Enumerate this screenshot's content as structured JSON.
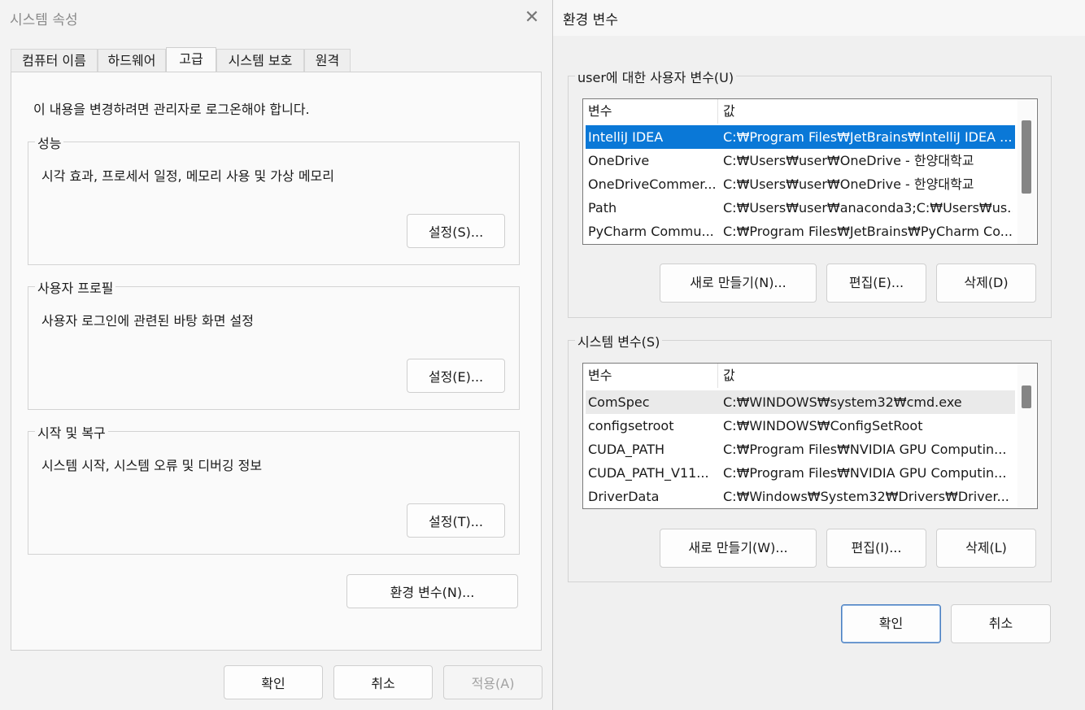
{
  "system_properties": {
    "title": "시스템 속성",
    "close_glyph": "✕",
    "tabs": [
      {
        "label": "컴퓨터 이름"
      },
      {
        "label": "하드웨어"
      },
      {
        "label": "고급"
      },
      {
        "label": "시스템 보호"
      },
      {
        "label": "원격"
      }
    ],
    "admin_note": "이 내용을 변경하려면 관리자로 로그온해야 합니다.",
    "groups": {
      "performance": {
        "title": "성능",
        "desc": "시각 효과, 프로세서 일정, 메모리 사용 및 가상 메모리",
        "button": "설정(S)..."
      },
      "user_profile": {
        "title": "사용자 프로필",
        "desc": "사용자 로그인에 관련된 바탕 화면 설정",
        "button": "설정(E)..."
      },
      "startup_recovery": {
        "title": "시작 및 복구",
        "desc": "시스템 시작, 시스템 오류 및 디버깅 정보",
        "button": "설정(T)..."
      }
    },
    "env_button": "환경 변수(N)...",
    "footer": {
      "ok": "확인",
      "cancel": "취소",
      "apply": "적용(A)"
    }
  },
  "environment_variables": {
    "title": "환경 변수",
    "user_section": {
      "title": "user에 대한 사용자 변수(U)",
      "columns": {
        "name": "변수",
        "value": "값"
      },
      "rows": [
        {
          "name": "IntelliJ IDEA",
          "value": "C:₩Program Files₩JetBrains₩IntelliJ IDEA ..."
        },
        {
          "name": "OneDrive",
          "value": "C:₩Users₩user₩OneDrive - 한양대학교"
        },
        {
          "name": "OneDriveCommer...",
          "value": "C:₩Users₩user₩OneDrive - 한양대학교"
        },
        {
          "name": "Path",
          "value": "C:₩Users₩user₩anaconda3;C:₩Users₩us..."
        },
        {
          "name": "PyCharm Commu...",
          "value": "C:₩Program Files₩JetBrains₩PyCharm Co..."
        }
      ],
      "buttons": {
        "new": "새로 만들기(N)...",
        "edit": "편집(E)...",
        "delete": "삭제(D)"
      }
    },
    "system_section": {
      "title": "시스템 변수(S)",
      "columns": {
        "name": "변수",
        "value": "값"
      },
      "rows": [
        {
          "name": "ComSpec",
          "value": "C:₩WINDOWS₩system32₩cmd.exe"
        },
        {
          "name": "configsetroot",
          "value": "C:₩WINDOWS₩ConfigSetRoot"
        },
        {
          "name": "CUDA_PATH",
          "value": "C:₩Program Files₩NVIDIA GPU Computin..."
        },
        {
          "name": "CUDA_PATH_V11...",
          "value": "C:₩Program Files₩NVIDIA GPU Computin..."
        },
        {
          "name": "DriverData",
          "value": "C:₩Windows₩System32₩Drivers₩Driver..."
        }
      ],
      "buttons": {
        "new": "새로 만들기(W)...",
        "edit": "편집(I)...",
        "delete": "삭제(L)"
      }
    },
    "footer": {
      "ok": "확인",
      "cancel": "취소"
    }
  }
}
